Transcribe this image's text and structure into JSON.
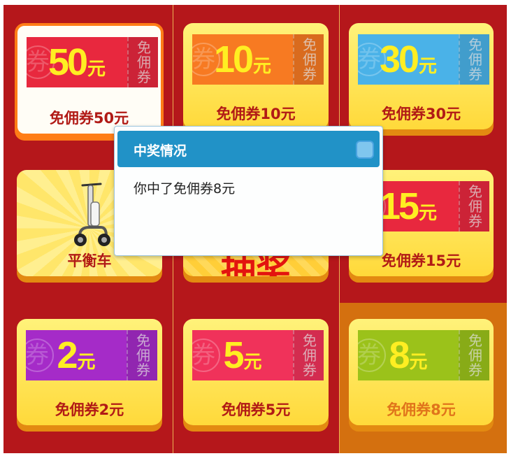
{
  "colors": {
    "board": "#b5171b",
    "highlight_cell": "#d4700f",
    "tile_yellow": "#ffe34a",
    "tile_shadow": "#e38a11",
    "caption_red": "#b11a16",
    "dialog_header": "#2192c7"
  },
  "coupon_watermark": "券",
  "stub_text": [
    "免",
    "佣",
    "券"
  ],
  "unit": "元",
  "tiles": [
    {
      "amount": "50",
      "caption": "免佣券50元",
      "ticket_color": "#e8283e",
      "style": "selected"
    },
    {
      "amount": "10",
      "caption": "免佣券10元",
      "ticket_color": "#f77a22"
    },
    {
      "amount": "30",
      "caption": "免佣券30元",
      "ticket_color": "#4ab2e8"
    },
    {
      "caption": "平衡车",
      "kind": "scooter",
      "icon": "scooter-icon"
    },
    {
      "caption": "抽奖",
      "kind": "draw-button"
    },
    {
      "amount": "15",
      "caption": "免佣券15元",
      "ticket_color": "#e8283e"
    },
    {
      "amount": "2",
      "caption": "免佣券2元",
      "ticket_color": "#a52bc8"
    },
    {
      "amount": "5",
      "caption": "免佣券5元",
      "ticket_color": "#f0325a"
    },
    {
      "amount": "8",
      "caption": "免佣券8元",
      "ticket_color": "#9bc21a",
      "style": "current"
    }
  ],
  "dialog": {
    "title": "中奖情况",
    "message": "你中了免佣券8元",
    "close_icon": "close-icon"
  }
}
